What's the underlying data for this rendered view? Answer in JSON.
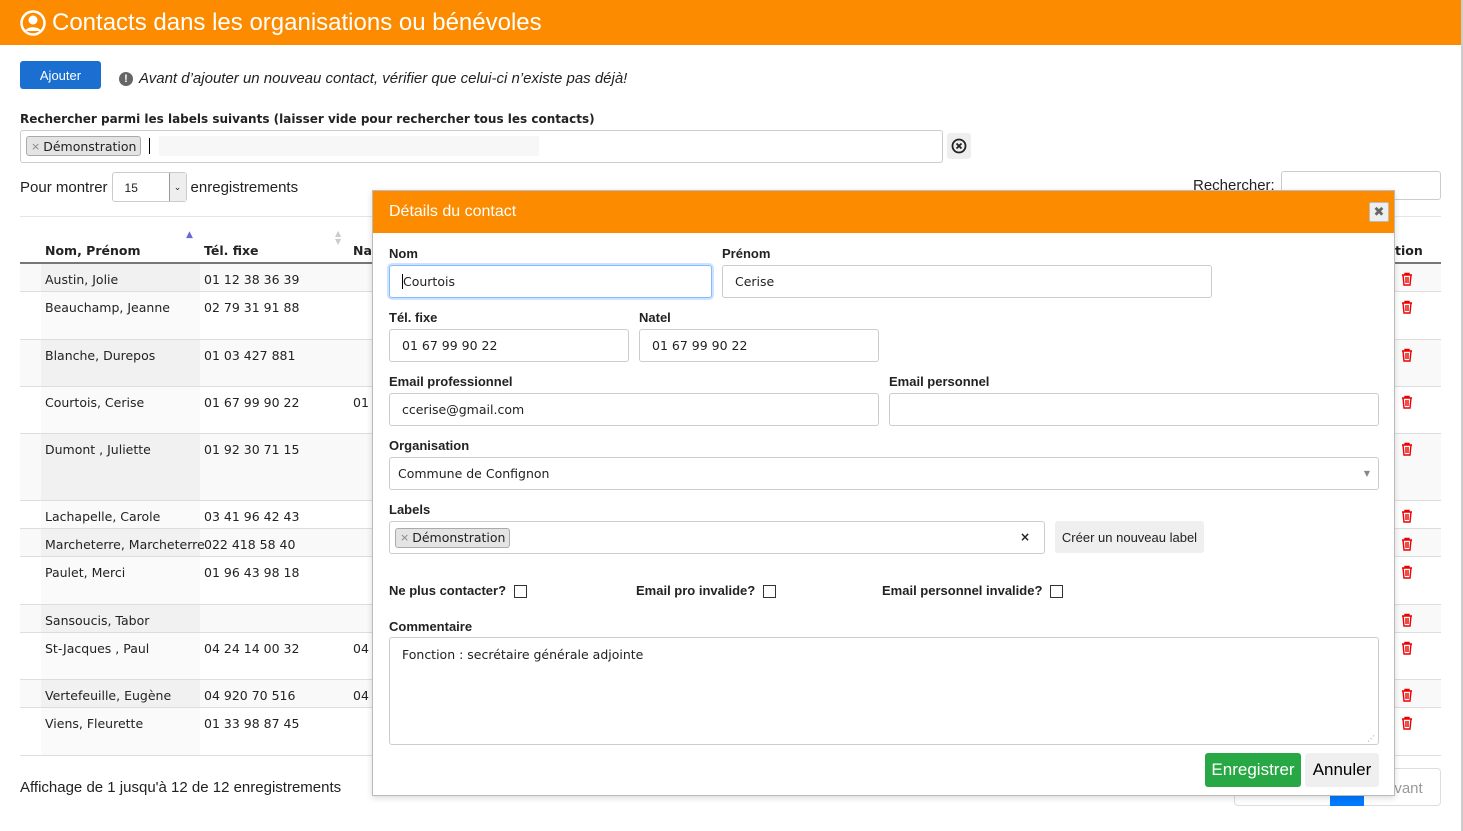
{
  "header": {
    "title": "Contacts dans les organisations ou bénévoles",
    "icon": "user-circle-icon",
    "color": "#fd8b00"
  },
  "toolbar": {
    "add_label": "Ajouter",
    "warning": "Avant d’ajouter un nouveau contact, vérifier que celui-ci n’existe pas déjà!"
  },
  "label_search": {
    "label": "Rechercher parmi les labels suivants (laisser vide pour rechercher tous les contacts)",
    "tags": [
      "Démonstration"
    ]
  },
  "length": {
    "prefix": "Pour montrer",
    "value": "15",
    "suffix": "enregistrements"
  },
  "search": {
    "label": "Rechercher:",
    "value": ""
  },
  "table": {
    "columns": [
      "Nom, Prénom",
      "Tél. fixe",
      "Na",
      "tion"
    ],
    "rows": [
      {
        "name": "Austin, Jolie",
        "tel": "01 12 38 36 39",
        "natel_partial": ""
      },
      {
        "name": "Beauchamp, Jeanne",
        "tel": "02 79 31 91 88",
        "natel_partial": ""
      },
      {
        "name": "Blanche, Durepos",
        "tel": "01 03 427 881",
        "natel_partial": ""
      },
      {
        "name": "Courtois, Cerise",
        "tel": "01 67 99 90 22",
        "natel_partial": "01"
      },
      {
        "name": "Dumont , Juliette",
        "tel": "01 92 30 71 15",
        "natel_partial": ""
      },
      {
        "name": "Lachapelle, Carole",
        "tel": "03 41 96 42 43",
        "natel_partial": ""
      },
      {
        "name": "Marcheterre, Marcheterre",
        "tel": "022 418 58 40",
        "natel_partial": ""
      },
      {
        "name": "Paulet, Merci",
        "tel": "01 96 43 98 18",
        "natel_partial": ""
      },
      {
        "name": "Sansoucis, Tabor",
        "tel": "",
        "natel_partial": ""
      },
      {
        "name": "St-Jacques , Paul",
        "tel": "04 24 14 00 32",
        "natel_partial": "04"
      },
      {
        "name": "Vertefeuille, Eugène",
        "tel": "04 920 70 516",
        "natel_partial": "04"
      },
      {
        "name": "Viens, Fleurette",
        "tel": "01 33 98 87 45",
        "natel_partial": ""
      }
    ]
  },
  "footer": {
    "info": "Affichage de 1 jusqu'à 12 de 12 enregistrements",
    "next_partial": "ivant"
  },
  "modal": {
    "title": "Détails du contact",
    "fields": {
      "nom": {
        "label": "Nom",
        "value": "Courtois"
      },
      "prenom": {
        "label": "Prénom",
        "value": "Cerise"
      },
      "tel": {
        "label": "Tél. fixe",
        "value": "01 67 99 90 22"
      },
      "natel": {
        "label": "Natel",
        "value": "01 67 99 90 22"
      },
      "email_pro": {
        "label": "Email professionnel",
        "value": "ccerise@gmail.com"
      },
      "email_perso": {
        "label": "Email personnel",
        "value": ""
      },
      "organisation": {
        "label": "Organisation",
        "value": "Commune de Confignon"
      },
      "labels": {
        "label": "Labels",
        "tags": [
          "Démonstration"
        ],
        "create_label": "Créer un nouveau label"
      },
      "ne_plus_contacter": {
        "label": "Ne plus contacter?",
        "checked": false
      },
      "email_pro_invalide": {
        "label": "Email pro invalide?",
        "checked": false
      },
      "email_perso_invalide": {
        "label": "Email personnel invalide?",
        "checked": false
      },
      "commentaire": {
        "label": "Commentaire",
        "value": "Fonction : secrétaire générale adjointe"
      }
    },
    "save_label": "Enregistrer",
    "cancel_label": "Annuler",
    "save_color": "#28a745"
  }
}
